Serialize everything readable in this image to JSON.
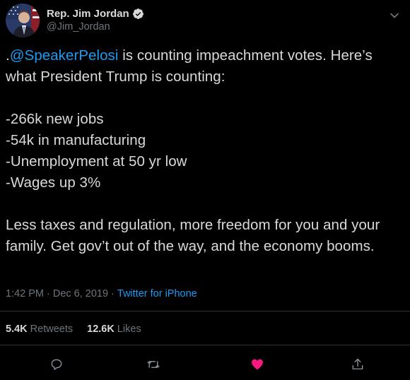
{
  "author": {
    "display_name": "Rep. Jim Jordan",
    "handle": "@Jim_Jordan",
    "verified": true
  },
  "tweet": {
    "mention": "@SpeakerPelosi",
    "line1_prefix": ".",
    "line1_rest": " is counting impeachment votes. Here’s what President Trump is counting:",
    "bullets": [
      "-266k new jobs",
      "-54k in manufacturing",
      "-Unemployment at 50 yr low",
      "-Wages up 3%"
    ],
    "closing": "Less taxes and regulation, more freedom for you and your family. Get gov’t out of the way, and the economy booms."
  },
  "meta": {
    "time": "1:42 PM",
    "separator": "·",
    "date": "Dec 6, 2019",
    "source": "Twitter for iPhone"
  },
  "stats": {
    "retweets_count": "5.4K",
    "retweets_label": "Retweets",
    "likes_count": "12.6K",
    "likes_label": "Likes"
  },
  "actions": {
    "reply_icon": "reply-icon",
    "retweet_icon": "retweet-icon",
    "like_icon": "heart-icon",
    "share_icon": "share-icon",
    "liked": true
  },
  "colors": {
    "background": "#000000",
    "text": "#d9d9d9",
    "secondary": "#6e767d",
    "link": "#1d9bf0",
    "like": "#f91880",
    "divider": "#2f3336"
  }
}
